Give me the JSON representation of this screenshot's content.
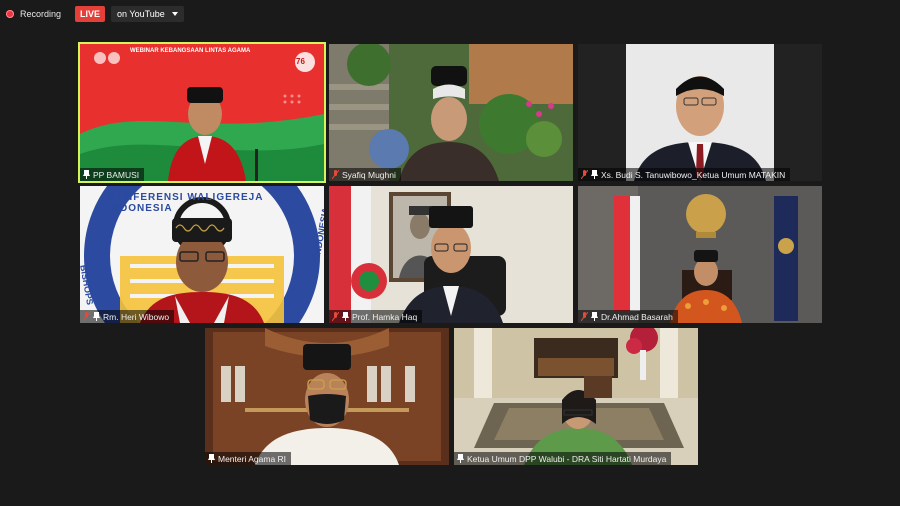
{
  "recording": {
    "label": "Recording"
  },
  "live": {
    "badge": "LIVE",
    "destination": "on YouTube"
  },
  "banner": {
    "title": "WEBINAR KEBANGSAAN LINTAS AGAMA",
    "anniversary": "76"
  },
  "logo_text": {
    "top": "KONFERENSI WALIGEREJA INDONESIA",
    "left": "BISHOPS",
    "right": "INDONESIA"
  },
  "participants": [
    {
      "name": "PP BAMUSI",
      "muted": false,
      "active": true
    },
    {
      "name": "Syafiq Mughni",
      "muted": true,
      "active": false
    },
    {
      "name": "Xs. Budi S. Tanuwibowo_Ketua Umum MATAKIN",
      "muted": true,
      "active": false
    },
    {
      "name": "Rm. Heri Wibowo",
      "muted": true,
      "active": false
    },
    {
      "name": "Prof. Hamka Haq",
      "muted": true,
      "active": false
    },
    {
      "name": "Dr.Ahmad Basarah",
      "muted": true,
      "active": false
    },
    {
      "name": "Menteri Agama RI",
      "muted": false,
      "active": false
    },
    {
      "name": "Ketua Umum DPP Walubi - DRA Siti Hartati Murdaya",
      "muted": false,
      "active": false
    }
  ],
  "colors": {
    "active_border": "#d6f35b",
    "live_red": "#e3403a",
    "muted_red": "#e34a3a",
    "background": "#1a1a1a"
  }
}
